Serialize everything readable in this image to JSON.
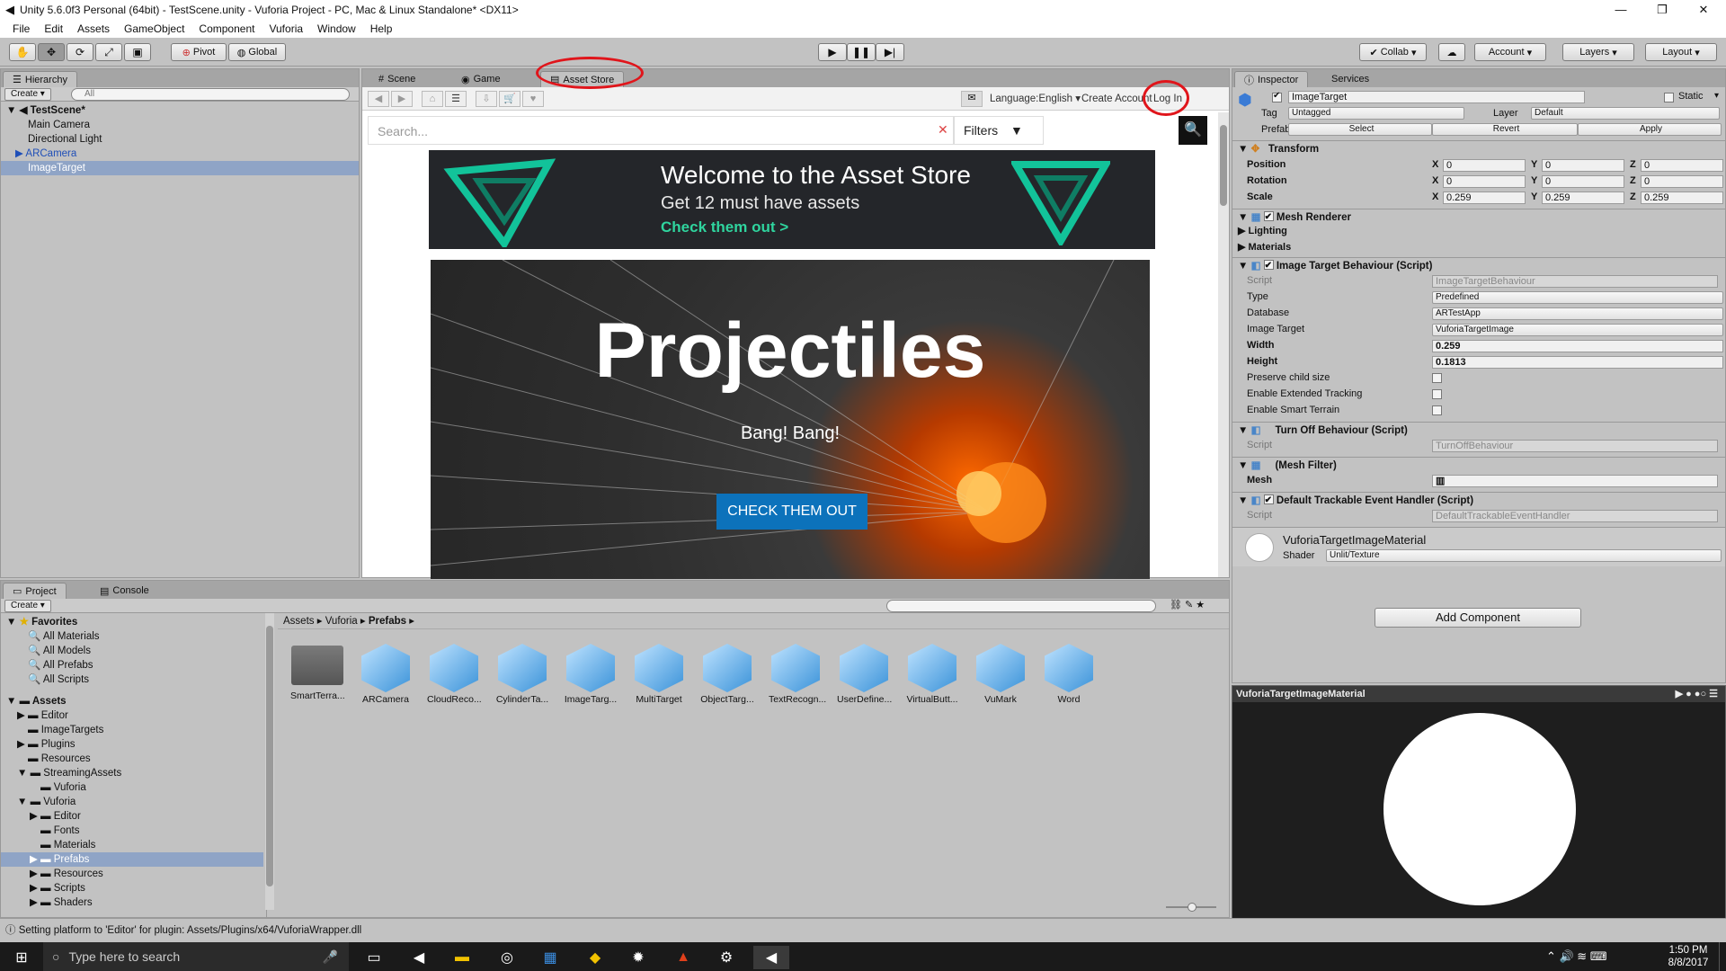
{
  "window": {
    "title": "Unity 5.6.0f3 Personal (64bit) - TestScene.unity - Vuforia Project - PC, Mac & Linux Standalone* <DX11>"
  },
  "menu": [
    "File",
    "Edit",
    "Assets",
    "GameObject",
    "Component",
    "Vuforia",
    "Window",
    "Help"
  ],
  "toolbar": {
    "pivot": "Pivot",
    "global": "Global",
    "collab": "Collab",
    "account": "Account",
    "layers": "Layers",
    "layout": "Layout"
  },
  "hierarchy": {
    "tab": "Hierarchy",
    "create": "Create",
    "search_placeholder": "All",
    "scene": "TestScene*",
    "items": [
      "Main Camera",
      "Directional Light",
      "ARCamera",
      "ImageTarget"
    ]
  },
  "center_tabs": [
    "Scene",
    "Game",
    "Asset Store"
  ],
  "store": {
    "language": "Language:English",
    "create_account": "Create Account",
    "log_in": "Log In",
    "search_placeholder": "Search...",
    "filters": "Filters",
    "banner1": {
      "title": "Welcome to the Asset Store",
      "subtitle": "Get 12 must have assets",
      "cta": "Check them out >"
    },
    "banner2": {
      "title": "Projectiles",
      "subtitle": "Bang! Bang!",
      "cta": "CHECK THEM OUT"
    }
  },
  "inspector": {
    "tabs": [
      "Inspector",
      "Services"
    ],
    "object_name": "ImageTarget",
    "static": "Static",
    "tag_label": "Tag",
    "tag_value": "Untagged",
    "layer_label": "Layer",
    "layer_value": "Default",
    "prefab_label": "Prefab",
    "prefab_select": "Select",
    "prefab_revert": "Revert",
    "prefab_apply": "Apply",
    "transform": {
      "title": "Transform",
      "position": "Position",
      "rotation": "Rotation",
      "scale": "Scale",
      "pos": [
        "0",
        "0",
        "0"
      ],
      "rot": [
        "0",
        "0",
        "0"
      ],
      "scl": [
        "0.259",
        "0.259",
        "0.259"
      ]
    },
    "mesh_renderer": {
      "title": "Mesh Renderer",
      "lighting": "Lighting",
      "materials": "Materials"
    },
    "itb": {
      "title": "Image Target Behaviour (Script)",
      "script_label": "Script",
      "script_value": "ImageTargetBehaviour",
      "type_label": "Type",
      "type_value": "Predefined",
      "database_label": "Database",
      "database_value": "ARTestApp",
      "image_target_label": "Image Target",
      "image_target_value": "VuforiaTargetImage",
      "width_label": "Width",
      "width_value": "0.259",
      "height_label": "Height",
      "height_value": "0.1813",
      "preserve": "Preserve child size",
      "ext_tracking": "Enable Extended Tracking",
      "smart_terrain": "Enable Smart Terrain"
    },
    "turnoff": {
      "title": "Turn Off Behaviour (Script)",
      "script_label": "Script",
      "script_value": "TurnOffBehaviour"
    },
    "mesh_filter": {
      "title": "(Mesh Filter)",
      "mesh_label": "Mesh"
    },
    "dteh": {
      "title": "Default Trackable Event Handler (Script)",
      "script_label": "Script",
      "script_value": "DefaultTrackableEventHandler"
    },
    "material": {
      "name": "VuforiaTargetImageMaterial",
      "shader_label": "Shader",
      "shader_value": "Unlit/Texture"
    },
    "add_component": "Add Component",
    "preview_title": "VuforiaTargetImageMaterial"
  },
  "project": {
    "tabs": [
      "Project",
      "Console"
    ],
    "create": "Create",
    "favorites_title": "Favorites",
    "favorites": [
      "All Materials",
      "All Models",
      "All Prefabs",
      "All Scripts"
    ],
    "assets_title": "Assets",
    "tree": [
      "Editor",
      "ImageTargets",
      "Plugins",
      "Resources",
      "StreamingAssets",
      "Vuforia",
      "Vuforia",
      "Editor",
      "Fonts",
      "Materials",
      "Prefabs",
      "Resources",
      "Scripts",
      "Shaders"
    ],
    "breadcrumb": [
      "Assets",
      "Vuforia",
      "Prefabs"
    ],
    "items": [
      "SmartTerra...",
      "ARCamera",
      "CloudReco...",
      "CylinderTa...",
      "ImageTarg...",
      "MultiTarget",
      "ObjectTarg...",
      "TextRecogn...",
      "UserDefine...",
      "VirtualButt...",
      "VuMark",
      "Word"
    ]
  },
  "status": "Setting platform to 'Editor' for plugin: Assets/Plugins/x64/VuforiaWrapper.dll",
  "taskbar": {
    "search_placeholder": "Type here to search",
    "time": "1:50 PM",
    "date": "8/8/2017"
  }
}
